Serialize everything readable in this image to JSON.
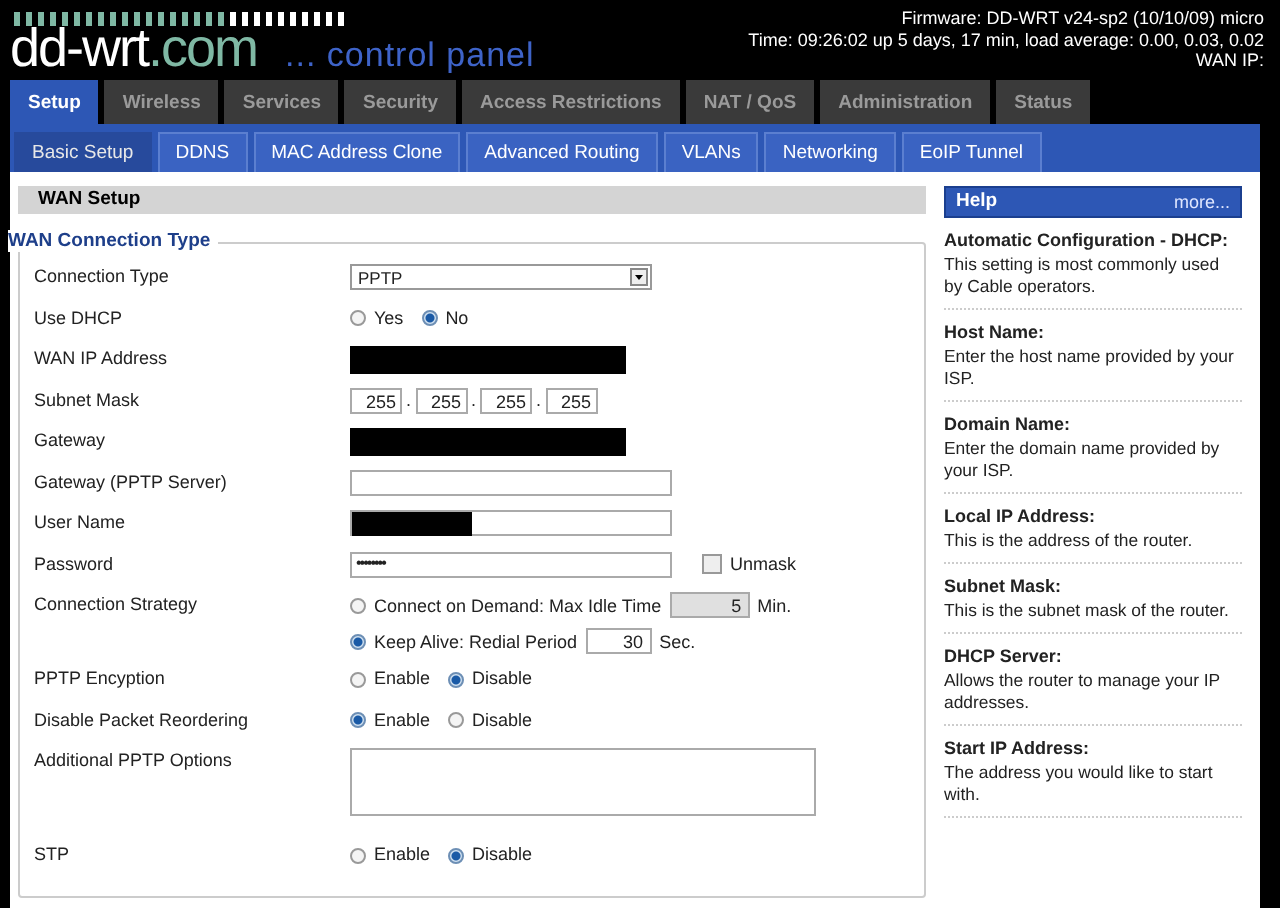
{
  "header": {
    "logo_main": "dd-wrt",
    "logo_suffix": ".com",
    "logo_tagline": "... control panel",
    "info": [
      "Firmware: DD-WRT v24-sp2 (10/10/09) micro",
      "Time: 09:26:02 up 5 days, 17 min, load average: 0.00, 0.03, 0.02",
      "WAN IP:"
    ]
  },
  "tabs": [
    {
      "label": "Setup",
      "selected": true
    },
    {
      "label": "Wireless",
      "selected": false
    },
    {
      "label": "Services",
      "selected": false
    },
    {
      "label": "Security",
      "selected": false
    },
    {
      "label": "Access Restrictions",
      "selected": false
    },
    {
      "label": "NAT / QoS",
      "selected": false
    },
    {
      "label": "Administration",
      "selected": false
    },
    {
      "label": "Status",
      "selected": false
    }
  ],
  "subtabs": [
    {
      "label": "Basic Setup",
      "selected": true
    },
    {
      "label": "DDNS",
      "selected": false
    },
    {
      "label": "MAC Address Clone",
      "selected": false
    },
    {
      "label": "Advanced Routing",
      "selected": false
    },
    {
      "label": "VLANs",
      "selected": false
    },
    {
      "label": "Networking",
      "selected": false
    },
    {
      "label": "EoIP Tunnel",
      "selected": false
    }
  ],
  "section_title": "WAN Setup",
  "fieldset_legend": "WAN Connection Type",
  "rows": [
    {
      "label": "Connection Type",
      "kind": "select",
      "value": "PPTP"
    },
    {
      "label": "Use DHCP",
      "kind": "radio",
      "options": [
        {
          "label": "Yes",
          "selected": false
        },
        {
          "label": "No",
          "selected": true
        }
      ]
    },
    {
      "label": "WAN IP Address",
      "kind": "redacted"
    },
    {
      "label": "Subnet Mask",
      "kind": "ip",
      "octets": [
        "255",
        "255",
        "255",
        "255"
      ],
      "separator": "."
    },
    {
      "label": "Gateway",
      "kind": "redacted"
    },
    {
      "label": "Gateway (PPTP Server)",
      "kind": "text",
      "redacted": false
    },
    {
      "label": "User Name",
      "kind": "text",
      "redacted": true
    },
    {
      "label": "Password",
      "kind": "password",
      "value": "••••••••",
      "unmask": {
        "label": "Unmask",
        "checked": false
      }
    },
    {
      "label": "Connection Strategy",
      "kind": "strategy",
      "options": [
        {
          "label": "Connect on Demand: Max Idle Time",
          "selected": false,
          "value": "5",
          "unit": "Min.",
          "disabled": true
        },
        {
          "label": "Keep Alive: Redial Period",
          "selected": true,
          "value": "30",
          "unit": "Sec.",
          "disabled": false
        }
      ]
    },
    {
      "label": "PPTP Encyption",
      "kind": "radio",
      "options": [
        {
          "label": "Enable",
          "selected": false
        },
        {
          "label": "Disable",
          "selected": true
        }
      ]
    },
    {
      "label": "Disable Packet Reordering",
      "kind": "radio",
      "options": [
        {
          "label": "Enable",
          "selected": true
        },
        {
          "label": "Disable",
          "selected": false
        }
      ]
    },
    {
      "label": "Additional PPTP Options",
      "kind": "textarea"
    },
    {
      "label": "STP",
      "kind": "radio",
      "options": [
        {
          "label": "Enable",
          "selected": false
        },
        {
          "label": "Disable",
          "selected": true
        }
      ]
    }
  ],
  "help": {
    "title": "Help",
    "more": "more...",
    "entries": [
      {
        "title": "Automatic Configuration - DHCP:",
        "text": "This setting is most commonly used by Cable operators."
      },
      {
        "title": "Host Name:",
        "text": "Enter the host name provided by your ISP."
      },
      {
        "title": "Domain Name:",
        "text": "Enter the domain name provided by your ISP."
      },
      {
        "title": "Local IP Address:",
        "text": "This is the address of the router."
      },
      {
        "title": "Subnet Mask:",
        "text": "This is the subnet mask of the router."
      },
      {
        "title": "DHCP Server:",
        "text": "Allows the router to manage your IP addresses."
      },
      {
        "title": "Start IP Address:",
        "text": "The address you would like to start with."
      }
    ]
  }
}
